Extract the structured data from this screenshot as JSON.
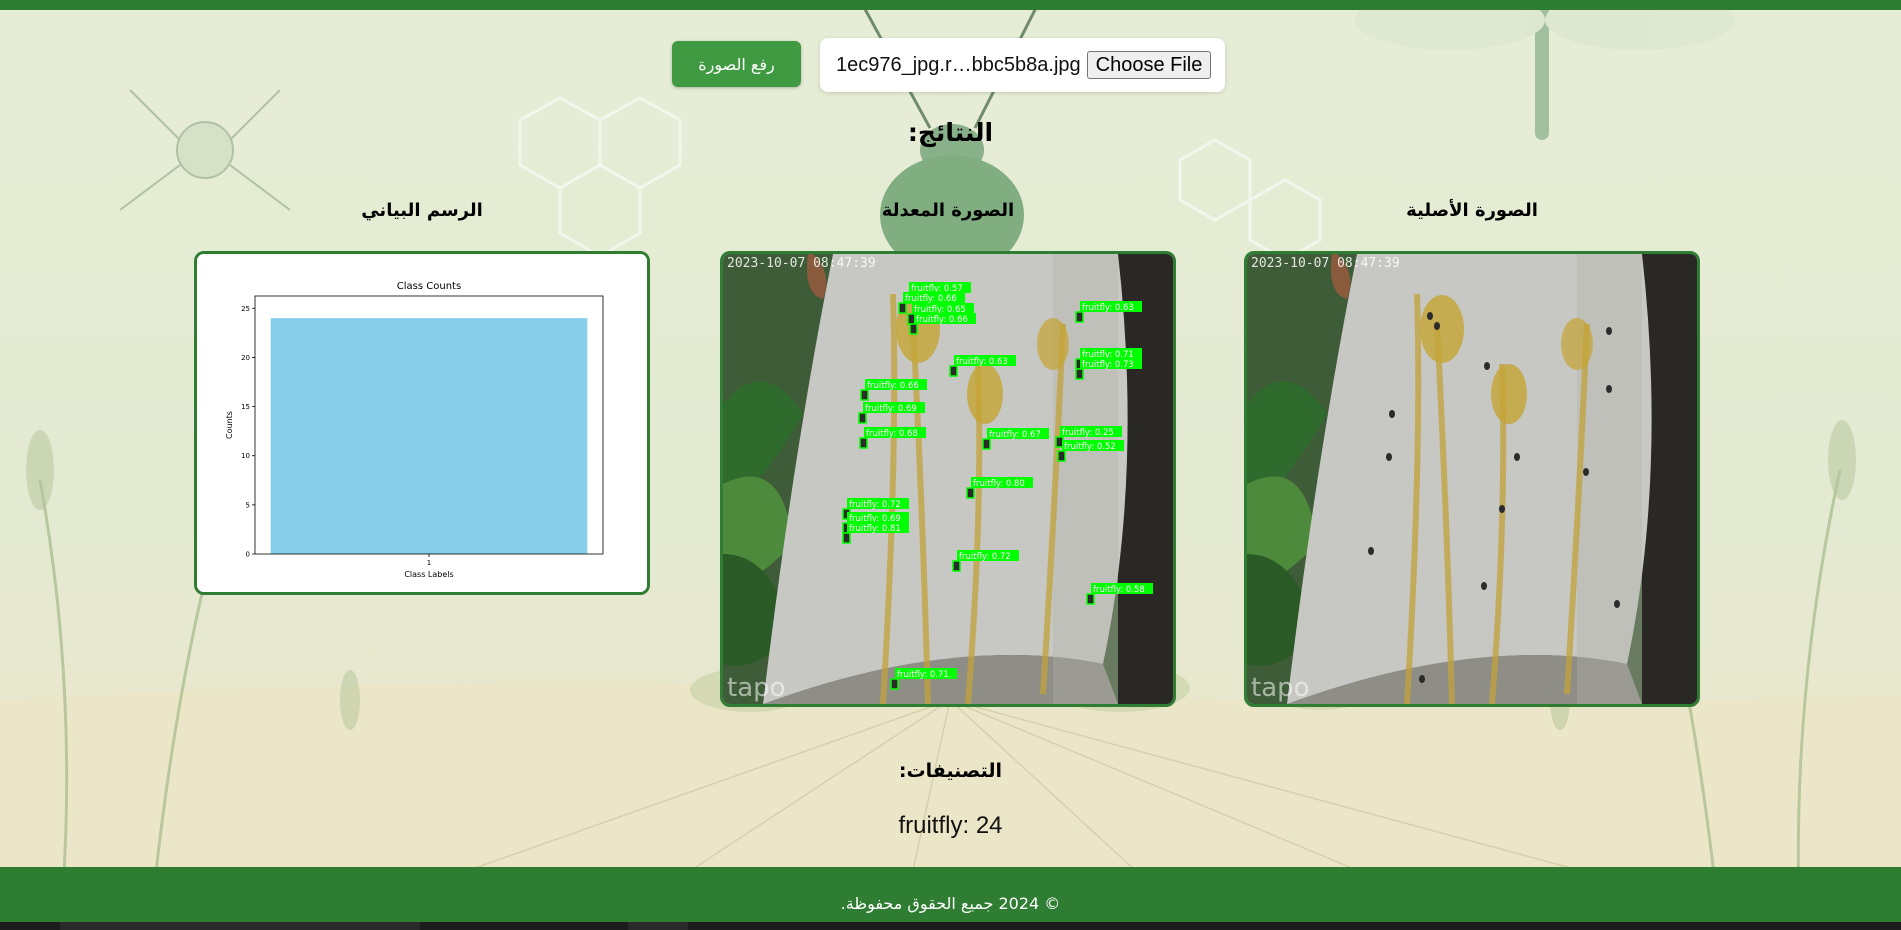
{
  "upload": {
    "submit_label": "رفع الصورة",
    "file_name": "1ec976_jpg.r…bbc5b8a.jpg",
    "choose_label": "Choose File"
  },
  "results": {
    "title": "النتائج:",
    "original_title": "الصورة الأصلية",
    "modified_title": "الصورة المعدلة",
    "chart_title_label": "الرسم البياني"
  },
  "photo": {
    "timestamp": "2023-10-07 08:47:39",
    "watermark": "tapo"
  },
  "detections": [
    {
      "label": "fruitfly: 0.57"
    },
    {
      "label": "fruitfly: 0.66"
    },
    {
      "label": "fruitfly: 0.65"
    },
    {
      "label": "fruitfly: 0.66"
    },
    {
      "label": "fruitfly: 0.63"
    },
    {
      "label": "fruitfly: 0.63"
    },
    {
      "label": "fruitfly: 0.71"
    },
    {
      "label": "fruitfly: 0.73"
    },
    {
      "label": "fruitfly: 0.66"
    },
    {
      "label": "fruitfly: 0.69"
    },
    {
      "label": "fruitfly: 0.68"
    },
    {
      "label": "fruitfly: 0.67"
    },
    {
      "label": "fruitfly: 0.25"
    },
    {
      "label": "fruitfly: 0.52"
    },
    {
      "label": "fruitfly: 0.80"
    },
    {
      "label": "fruitfly: 0.72"
    },
    {
      "label": "fruitfly: 0.69"
    },
    {
      "label": "fruitfly: 0.81"
    },
    {
      "label": "fruitfly: 0.72"
    },
    {
      "label": "fruitfly: 0.58"
    },
    {
      "label": "fruitfly: 0.71"
    }
  ],
  "chart_data": {
    "type": "bar",
    "title": "Class Counts",
    "xlabel": "Class Labels",
    "ylabel": "Counts",
    "categories": [
      "1"
    ],
    "values": [
      24
    ],
    "ylim": [
      0,
      25
    ],
    "yticks": [
      "0",
      "5",
      "10",
      "15",
      "20",
      "25"
    ],
    "bar_color": "#87ceeb",
    "grid": false
  },
  "classifications": {
    "title": "التصنيفات:",
    "items": [
      {
        "text": "fruitfly: 24"
      }
    ]
  },
  "footer": {
    "text": "© 2024 جميع الحقوق محفوظة."
  },
  "colors": {
    "primary": "#2e7d32",
    "button": "#3f9a42",
    "detection_box": "#00ff00"
  }
}
